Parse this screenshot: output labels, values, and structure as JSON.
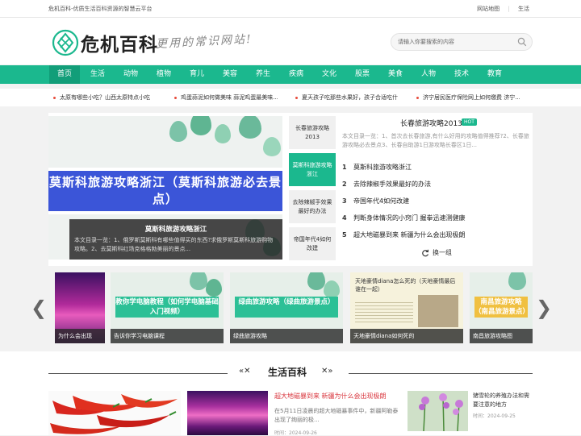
{
  "topbar": {
    "slogan": "危机百科-优质生活百科资源的智慧云平台",
    "links": [
      "网站地图",
      "生活"
    ]
  },
  "header": {
    "logo_text": "危机百科",
    "tagline": "更用的常识网站!",
    "search_placeholder": "请输入你要搜索的内容"
  },
  "nav": {
    "items": [
      "首页",
      "生活",
      "动物",
      "植物",
      "育儿",
      "美容",
      "养生",
      "疾病",
      "文化",
      "股票",
      "美食",
      "人物",
      "技术",
      "教育"
    ]
  },
  "ticker": [
    "太原有哪些小吃？山西太原特点小吃",
    "鸡蛋蒜泥如何做美味 蒜泥鸡蛋最美味...",
    "夏天孩子吃那些水果好，孩子合适吃什",
    "济宁居民医疗保险网上如何缴费 济宁..."
  ],
  "slider": {
    "banner_text": "莫斯科旅游攻略浙江（莫斯科旅游必去景点）",
    "caption_title": "莫斯科旅游攻略浙江",
    "caption_desc": "本文目录一览：1、俄罗斯莫斯科有哪些值得买的东西?求俄罗斯莫斯科旅游购物攻略。2、去莫斯科红场克格格勃美丽的景点..."
  },
  "tabs": [
    "长春旅游攻略2013",
    "莫斯科旅游攻略浙江",
    "去除辣椒手效果最好的办法",
    "帝国年代4如何改建"
  ],
  "hot": {
    "title": "长春旅游攻略2013",
    "badge": "HOT",
    "summary": "本文目录一览：1、首次去长春旅游,有什么好用的攻略值得推荐?2、长春旅游攻略必去景点3、长春自助游1日游攻略长春区1日...",
    "list": [
      {
        "num": "1",
        "text": "莫斯科旅游攻略浙江"
      },
      {
        "num": "2",
        "text": "去除辣椒手效果最好的办法"
      },
      {
        "num": "3",
        "text": "帝国年代4如何改建"
      },
      {
        "num": "4",
        "text": "判断身体情况的小窍门 握拳迅速测健康"
      },
      {
        "num": "5",
        "text": "超大地磁暴到来 新疆为什么会出现极朗"
      }
    ],
    "swap_label": "换一组"
  },
  "carousel": {
    "items": [
      {
        "label": "为什么会出现",
        "banner": ""
      },
      {
        "label": "告诉你学习电脑课程",
        "banner": "教你学电脑教程（如何学电脑基础入门视频）"
      },
      {
        "label": "绿曲旅游攻略",
        "banner": "绿曲旅游攻略（绿曲旅游景点）"
      },
      {
        "label": "天地豪情diana如何死的",
        "banner": "天地豪情diana怎么死的（天地豪情最后谁在一起）"
      },
      {
        "label": "南昌旅游攻略图",
        "banner": "南昌旅游攻略（南昌旅游景点）"
      }
    ]
  },
  "section": {
    "title": "生活百科",
    "news1": {
      "title": "超大地磁暴到来 新疆为什么会出现极朗",
      "desc": "在5月11日凌晨的超大地磁暴事件中，新疆阿勒泰出现了绚丽的极...",
      "date": "时间：2024-09-26"
    },
    "news2": {
      "title": "猪雪轮的养殖办法和需要注意的地方",
      "date": "时间：2024-09-25"
    }
  }
}
